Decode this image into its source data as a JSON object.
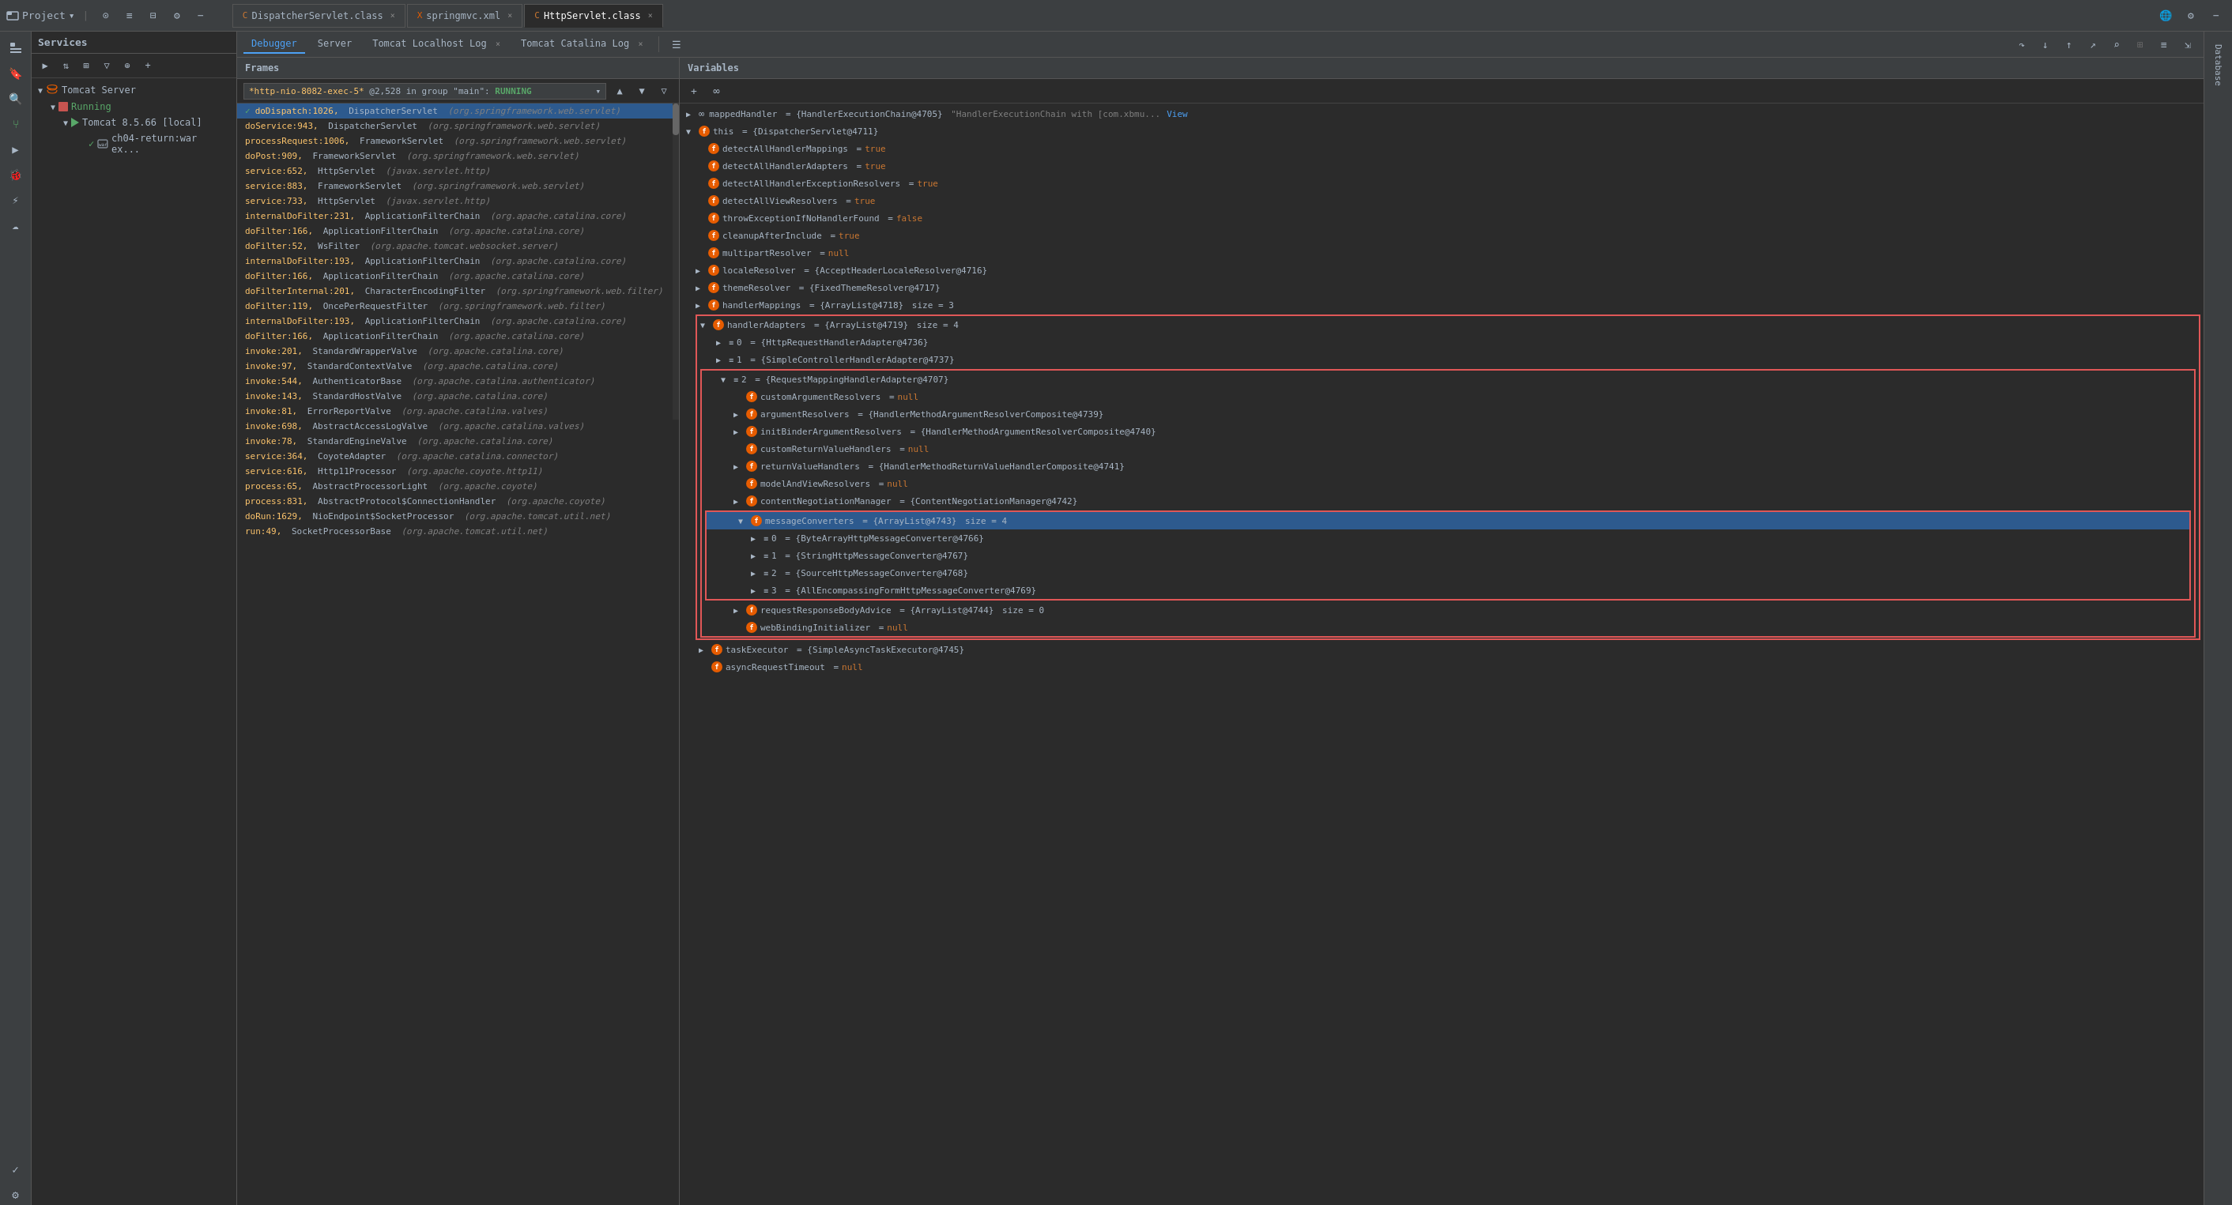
{
  "titleBar": {
    "projectLabel": "Project",
    "tabs": [
      {
        "label": "DispatcherServlet.class",
        "active": false,
        "icon": "class"
      },
      {
        "label": "springmvc.xml",
        "active": false,
        "icon": "xml"
      },
      {
        "label": "HttpServlet.class",
        "active": true,
        "icon": "class"
      }
    ]
  },
  "servicesPanel": {
    "title": "Services",
    "toolbar": {
      "icons": [
        "↑↓",
        "⊞",
        "≡",
        "▽",
        "⊕"
      ]
    },
    "tree": {
      "items": [
        {
          "label": "Tomcat Server",
          "level": 0,
          "expanded": true,
          "type": "server"
        },
        {
          "label": "Running",
          "level": 1,
          "expanded": true,
          "type": "status"
        },
        {
          "label": "Tomcat 8.5.66 [local]",
          "level": 2,
          "expanded": true,
          "type": "instance"
        },
        {
          "label": "ch04-return:war ex...",
          "level": 3,
          "type": "app"
        }
      ]
    }
  },
  "debuggerToolbar": {
    "tabs": [
      {
        "label": "Debugger",
        "active": true
      },
      {
        "label": "Server",
        "active": false
      },
      {
        "label": "Tomcat Localhost Log",
        "active": false
      },
      {
        "label": "Tomcat Catalina Log",
        "active": false
      }
    ],
    "icons": [
      "↑",
      "↓",
      "↑↓",
      "↺",
      "⇅",
      "⊞",
      "≡"
    ]
  },
  "framesPanel": {
    "header": "Frames",
    "threadInfo": {
      "thread": "*http-nio-8082-exec-5*@2,528 in group \"main\": RUNNING",
      "status": "RUNNING"
    },
    "frames": [
      {
        "method": "doDispatch:1026,",
        "class": "DispatcherServlet",
        "package": "(org.springframework.web.servlet)",
        "selected": true,
        "check": true
      },
      {
        "method": "doService:943,",
        "class": "DispatcherServlet",
        "package": "(org.springframework.web.servlet)",
        "selected": false
      },
      {
        "method": "processRequest:1006,",
        "class": "FrameworkServlet",
        "package": "(org.springframework.web.servlet)",
        "selected": false
      },
      {
        "method": "doPost:909,",
        "class": "FrameworkServlet",
        "package": "(org.springframework.web.servlet)",
        "selected": false
      },
      {
        "method": "service:652,",
        "class": "HttpServlet",
        "package": "(javax.servlet.http)",
        "selected": false
      },
      {
        "method": "service:883,",
        "class": "FrameworkServlet",
        "package": "(org.springframework.web.servlet)",
        "selected": false
      },
      {
        "method": "service:733,",
        "class": "HttpServlet",
        "package": "(javax.servlet.http)",
        "selected": false
      },
      {
        "method": "internalDoFilter:231,",
        "class": "ApplicationFilterChain",
        "package": "(org.apache.catalina.core)",
        "selected": false
      },
      {
        "method": "doFilter:166,",
        "class": "ApplicationFilterChain",
        "package": "(org.apache.catalina.core)",
        "selected": false
      },
      {
        "method": "doFilter:52,",
        "class": "WsFilter",
        "package": "(org.apache.tomcat.websocket.server)",
        "selected": false
      },
      {
        "method": "internalDoFilter:193,",
        "class": "ApplicationFilterChain",
        "package": "(org.apache.catalina.core)",
        "selected": false
      },
      {
        "method": "doFilter:166,",
        "class": "ApplicationFilterChain",
        "package": "(org.apache.catalina.core)",
        "selected": false
      },
      {
        "method": "doFilterInternal:201,",
        "class": "CharacterEncodingFilter",
        "package": "(org.springframework.web.filter)",
        "selected": false
      },
      {
        "method": "doFilter:119,",
        "class": "OncePerRequestFilter",
        "package": "(org.springframework.web.filter)",
        "selected": false
      },
      {
        "method": "internalDoFilter:193,",
        "class": "ApplicationFilterChain",
        "package": "(org.apache.catalina.core)",
        "selected": false
      },
      {
        "method": "doFilter:166,",
        "class": "ApplicationFilterChain",
        "package": "(org.apache.catalina.core)",
        "selected": false
      },
      {
        "method": "invoke:201,",
        "class": "StandardWrapperValve",
        "package": "(org.apache.catalina.core)",
        "selected": false
      },
      {
        "method": "invoke:97,",
        "class": "StandardContextValve",
        "package": "(org.apache.catalina.core)",
        "selected": false
      },
      {
        "method": "invoke:544,",
        "class": "AuthenticatorBase",
        "package": "(org.apache.catalina.authenticator)",
        "selected": false
      },
      {
        "method": "invoke:143,",
        "class": "StandardHostValve",
        "package": "(org.apache.catalina.core)",
        "selected": false
      },
      {
        "method": "invoke:81,",
        "class": "ErrorReportValve",
        "package": "(org.apache.catalina.valves)",
        "selected": false
      },
      {
        "method": "invoke:698,",
        "class": "AbstractAccessLogValve",
        "package": "(org.apache.catalina.valves)",
        "selected": false
      },
      {
        "method": "invoke:78,",
        "class": "StandardEngineValve",
        "package": "(org.apache.catalina.core)",
        "selected": false
      },
      {
        "method": "service:364,",
        "class": "CoyoteAdapter",
        "package": "(org.apache.catalina.connector)",
        "selected": false
      },
      {
        "method": "service:616,",
        "class": "Http11Processor",
        "package": "(org.apache.coyote.http11)",
        "selected": false
      },
      {
        "method": "process:65,",
        "class": "AbstractProcessorLight",
        "package": "(org.apache.coyote)",
        "selected": false
      },
      {
        "method": "process:831,",
        "class": "AbstractProtocol$ConnectionHandler",
        "package": "(org.apache.coyote)",
        "selected": false
      },
      {
        "method": "doRun:1629,",
        "class": "NioEndpoint$SocketProcessor",
        "package": "(org.apache.tomcat.util.net)",
        "selected": false
      },
      {
        "method": "run:49,",
        "class": "SocketProcessorBase",
        "package": "(org.apache.tomcat.util.net)",
        "selected": false
      }
    ]
  },
  "variablesPanel": {
    "header": "Variables",
    "variables": [
      {
        "name": "mappedHandler",
        "value": "= {HandlerExecutionChain@4705} \"HandlerExecutionChain with [com.xbmu... View",
        "level": 0,
        "expandable": true,
        "icon": "oo"
      },
      {
        "name": "this",
        "value": "= {DispatcherServlet@4711}",
        "level": 0,
        "expandable": true,
        "icon": "field"
      },
      {
        "name": "detectAllHandlerMappings",
        "value": "= true",
        "level": 1,
        "expandable": false,
        "icon": "field",
        "valueType": "bool"
      },
      {
        "name": "detectAllHandlerAdapters",
        "value": "= true",
        "level": 1,
        "expandable": false,
        "icon": "field",
        "valueType": "bool"
      },
      {
        "name": "detectAllHandlerExceptionResolvers",
        "value": "= true",
        "level": 1,
        "expandable": false,
        "icon": "field",
        "valueType": "bool"
      },
      {
        "name": "detectAllViewResolvers",
        "value": "= true",
        "level": 1,
        "expandable": false,
        "icon": "field",
        "valueType": "bool"
      },
      {
        "name": "throwExceptionIfNoHandlerFound",
        "value": "= false",
        "level": 1,
        "expandable": false,
        "icon": "field",
        "valueType": "bool"
      },
      {
        "name": "cleanupAfterInclude",
        "value": "= true",
        "level": 1,
        "expandable": false,
        "icon": "field",
        "valueType": "bool"
      },
      {
        "name": "multipartResolver",
        "value": "= null",
        "level": 1,
        "expandable": false,
        "icon": "field",
        "valueType": "null"
      },
      {
        "name": "localeResolver",
        "value": "= {AcceptHeaderLocaleResolver@4716}",
        "level": 1,
        "expandable": true,
        "icon": "field"
      },
      {
        "name": "themeResolver",
        "value": "= {FixedThemeResolver@4717}",
        "level": 1,
        "expandable": true,
        "icon": "field"
      },
      {
        "name": "handlerMappings",
        "value": "= {ArrayList@4718}  size = 3",
        "level": 1,
        "expandable": true,
        "icon": "field"
      },
      {
        "name": "handlerAdapters",
        "value": "= {ArrayList@4719}  size = 4",
        "level": 1,
        "expandable": true,
        "icon": "field",
        "redBox": true,
        "expanded": true
      },
      {
        "name": "0",
        "value": "= {HttpRequestHandlerAdapter@4736}",
        "level": 2,
        "expandable": true,
        "icon": "list"
      },
      {
        "name": "1",
        "value": "= {SimpleControllerHandlerAdapter@4737}",
        "level": 2,
        "expandable": true,
        "icon": "list"
      },
      {
        "name": "2",
        "value": "= {RequestMappingHandlerAdapter@4707}",
        "level": 2,
        "expandable": true,
        "icon": "list",
        "redBox": true,
        "expanded": true
      },
      {
        "name": "customArgumentResolvers",
        "value": "= null",
        "level": 3,
        "expandable": false,
        "icon": "field",
        "valueType": "null"
      },
      {
        "name": "argumentResolvers",
        "value": "= {HandlerMethodArgumentResolverComposite@4739}",
        "level": 3,
        "expandable": true,
        "icon": "field"
      },
      {
        "name": "initBinderArgumentResolvers",
        "value": "= {HandlerMethodArgumentResolverComposite@4740}",
        "level": 3,
        "expandable": true,
        "icon": "field"
      },
      {
        "name": "customReturnValueHandlers",
        "value": "= null",
        "level": 3,
        "expandable": false,
        "icon": "field",
        "valueType": "null"
      },
      {
        "name": "returnValueHandlers",
        "value": "= {HandlerMethodReturnValueHandlerComposite@4741}",
        "level": 3,
        "expandable": true,
        "icon": "field"
      },
      {
        "name": "modelAndViewResolvers",
        "value": "= null",
        "level": 3,
        "expandable": false,
        "icon": "field",
        "valueType": "null"
      },
      {
        "name": "contentNegotiationManager",
        "value": "= {ContentNegotiationManager@4742}",
        "level": 3,
        "expandable": true,
        "icon": "field"
      },
      {
        "name": "messageConverters",
        "value": "= {ArrayList@4743}  size = 4",
        "level": 3,
        "expandable": true,
        "icon": "field",
        "selected": true,
        "redBox": true,
        "expanded": true
      },
      {
        "name": "0",
        "value": "= {ByteArrayHttpMessageConverter@4766}",
        "level": 4,
        "expandable": true,
        "icon": "list"
      },
      {
        "name": "1",
        "value": "= {StringHttpMessageConverter@4767}",
        "level": 4,
        "expandable": true,
        "icon": "list"
      },
      {
        "name": "2",
        "value": "= {SourceHttpMessageConverter@4768}",
        "level": 4,
        "expandable": true,
        "icon": "list"
      },
      {
        "name": "3",
        "value": "= {AllEncompassingFormHttpMessageConverter@4769}",
        "level": 4,
        "expandable": true,
        "icon": "list"
      },
      {
        "name": "requestResponseBodyAdvice",
        "value": "= {ArrayList@4744}  size = 0",
        "level": 3,
        "expandable": true,
        "icon": "field"
      },
      {
        "name": "webBindingInitializer",
        "value": "= null",
        "level": 3,
        "expandable": false,
        "icon": "field",
        "valueType": "null"
      },
      {
        "name": "taskExecutor",
        "value": "= {SimpleAsyncTaskExecutor@4745}",
        "level": 2,
        "expandable": true,
        "icon": "field"
      },
      {
        "name": "asyncRequestTimeout",
        "value": "= null",
        "level": 2,
        "expandable": false,
        "icon": "field",
        "valueType": "null"
      }
    ]
  }
}
